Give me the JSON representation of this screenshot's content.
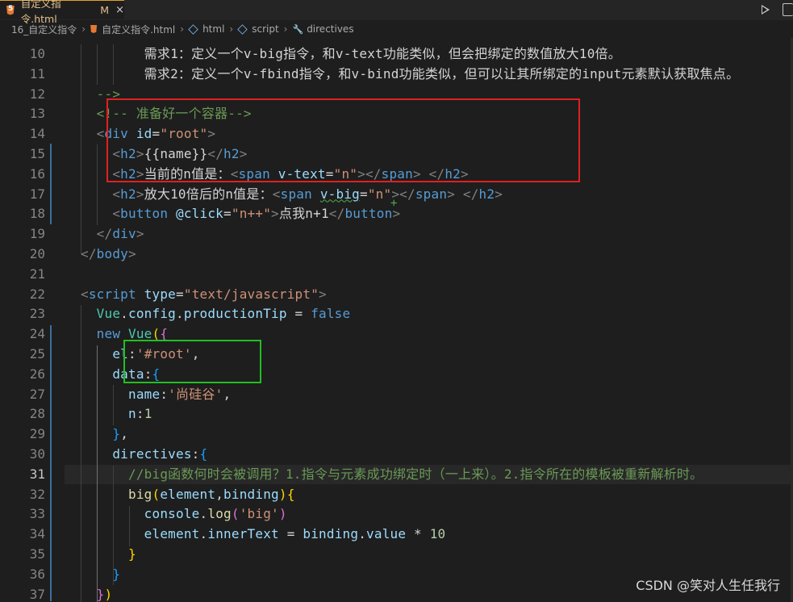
{
  "tab": {
    "title": "自定义指令.html",
    "modified": "M",
    "close": "×"
  },
  "breadcrumb": {
    "folder": "16_自定义指令",
    "file": "自定义指令.html",
    "items": [
      "html",
      "script",
      "directives"
    ]
  },
  "lines": [
    {
      "num": "10",
      "tokens": [
        [
          "txt",
          "        需求1：定义一个v-big指令，和v-text功能类似，但会把绑定的数值放大10倍。"
        ]
      ]
    },
    {
      "num": "11",
      "tokens": [
        [
          "txt",
          "        需求2：定义一个v-fbind指令，和v-bind功能类似，但可以让其所绑定的input元素默认获取焦点。"
        ]
      ]
    },
    {
      "num": "12",
      "tokens": [
        [
          "cmt",
          "  -->"
        ]
      ]
    },
    {
      "num": "13",
      "tokens": [
        [
          "cmt",
          "  <!-- 准备好一个容器-->"
        ]
      ]
    },
    {
      "num": "14",
      "tokens": [
        [
          "punct",
          "  <"
        ],
        [
          "tag",
          "div"
        ],
        [
          "txt",
          " "
        ],
        [
          "attr",
          "id"
        ],
        [
          "txt",
          "="
        ],
        [
          "str",
          "\"root\""
        ],
        [
          "punct",
          ">"
        ]
      ]
    },
    {
      "num": "15",
      "tokens": [
        [
          "punct",
          "    <"
        ],
        [
          "tag",
          "h2"
        ],
        [
          "punct",
          ">"
        ],
        [
          "txt",
          "{{name}}"
        ],
        [
          "punct",
          "</"
        ],
        [
          "tag",
          "h2"
        ],
        [
          "punct",
          ">"
        ]
      ]
    },
    {
      "num": "16",
      "tokens": [
        [
          "punct",
          "    <"
        ],
        [
          "tag",
          "h2"
        ],
        [
          "punct",
          ">"
        ],
        [
          "txt",
          "当前的n值是："
        ],
        [
          "punct",
          "<"
        ],
        [
          "tag",
          "span"
        ],
        [
          "txt",
          " "
        ],
        [
          "attr",
          "v-text"
        ],
        [
          "txt",
          "="
        ],
        [
          "str",
          "\"n\""
        ],
        [
          "punct",
          "></"
        ],
        [
          "tag",
          "span"
        ],
        [
          "punct",
          ">"
        ],
        [
          "txt",
          " "
        ],
        [
          "punct",
          "</"
        ],
        [
          "tag",
          "h2"
        ],
        [
          "punct",
          ">"
        ]
      ]
    },
    {
      "num": "17",
      "tokens": [
        [
          "punct",
          "    <"
        ],
        [
          "tag",
          "h2"
        ],
        [
          "punct",
          ">"
        ],
        [
          "txt",
          "放大10倍后的n值是："
        ],
        [
          "punct",
          "<"
        ],
        [
          "tag",
          "span"
        ],
        [
          "txt",
          " "
        ],
        [
          "attr squiggle",
          "v-big"
        ],
        [
          "txt",
          "="
        ],
        [
          "str",
          "\"n\""
        ],
        [
          "punct",
          "></"
        ],
        [
          "tag",
          "span"
        ],
        [
          "punct",
          ">"
        ],
        [
          "txt",
          " "
        ],
        [
          "punct",
          "</"
        ],
        [
          "tag",
          "h2"
        ],
        [
          "punct",
          ">"
        ]
      ]
    },
    {
      "num": "18",
      "tokens": [
        [
          "punct",
          "    <"
        ],
        [
          "tag",
          "button"
        ],
        [
          "txt",
          " "
        ],
        [
          "attr",
          "@click"
        ],
        [
          "txt",
          "="
        ],
        [
          "str",
          "\"n++\""
        ],
        [
          "punct",
          ">"
        ],
        [
          "txt",
          "点我n+1"
        ],
        [
          "punct",
          "</"
        ],
        [
          "tag",
          "button"
        ],
        [
          "punct",
          ">"
        ]
      ]
    },
    {
      "num": "19",
      "tokens": [
        [
          "punct",
          "  </"
        ],
        [
          "tag",
          "div"
        ],
        [
          "punct",
          ">"
        ]
      ]
    },
    {
      "num": "20",
      "tokens": [
        [
          "punct",
          "</"
        ],
        [
          "tag",
          "body"
        ],
        [
          "punct",
          ">"
        ]
      ]
    },
    {
      "num": "21",
      "tokens": []
    },
    {
      "num": "22",
      "tokens": [
        [
          "punct",
          "<"
        ],
        [
          "tag",
          "script"
        ],
        [
          "txt",
          " "
        ],
        [
          "attr",
          "type"
        ],
        [
          "txt",
          "="
        ],
        [
          "str",
          "\"text/javascript\""
        ],
        [
          "punct",
          ">"
        ]
      ]
    },
    {
      "num": "23",
      "tokens": [
        [
          "txt",
          "  "
        ],
        [
          "cls",
          "Vue"
        ],
        [
          "txt",
          "."
        ],
        [
          "var",
          "config"
        ],
        [
          "txt",
          "."
        ],
        [
          "var",
          "productionTip"
        ],
        [
          "txt",
          " = "
        ],
        [
          "kw",
          "false"
        ]
      ]
    },
    {
      "num": "24",
      "tokens": [
        [
          "txt",
          "  "
        ],
        [
          "kw",
          "new"
        ],
        [
          "txt",
          " "
        ],
        [
          "cls",
          "Vue"
        ],
        [
          "brk1",
          "("
        ],
        [
          "brk2",
          "{"
        ]
      ]
    },
    {
      "num": "25",
      "tokens": [
        [
          "txt",
          "    "
        ],
        [
          "var",
          "el"
        ],
        [
          "txt",
          ":"
        ],
        [
          "str",
          "'#root'"
        ],
        [
          "txt",
          ","
        ]
      ]
    },
    {
      "num": "26",
      "tokens": [
        [
          "txt",
          "    "
        ],
        [
          "var",
          "data"
        ],
        [
          "txt",
          ":"
        ],
        [
          "brk3",
          "{"
        ]
      ]
    },
    {
      "num": "27",
      "tokens": [
        [
          "txt",
          "      "
        ],
        [
          "var",
          "name"
        ],
        [
          "txt",
          ":"
        ],
        [
          "str",
          "'尚硅谷'"
        ],
        [
          "txt",
          ","
        ]
      ]
    },
    {
      "num": "28",
      "tokens": [
        [
          "txt",
          "      "
        ],
        [
          "var",
          "n"
        ],
        [
          "txt",
          ":"
        ],
        [
          "num",
          "1"
        ]
      ]
    },
    {
      "num": "29",
      "tokens": [
        [
          "txt",
          "    "
        ],
        [
          "brk3",
          "}"
        ],
        [
          "txt",
          ","
        ]
      ]
    },
    {
      "num": "30",
      "tokens": [
        [
          "txt",
          "    "
        ],
        [
          "var",
          "directives"
        ],
        [
          "txt",
          ":"
        ],
        [
          "brk3",
          "{"
        ]
      ]
    },
    {
      "num": "31",
      "tokens": [
        [
          "cmt",
          "      //big函数何时会被调用？1.指令与元素成功绑定时（一上来）。2.指令所在的模板被重新解析时。"
        ]
      ]
    },
    {
      "num": "32",
      "tokens": [
        [
          "txt",
          "      "
        ],
        [
          "fn",
          "big"
        ],
        [
          "brk1",
          "("
        ],
        [
          "var",
          "element"
        ],
        [
          "txt",
          ","
        ],
        [
          "var",
          "binding"
        ],
        [
          "brk1",
          ")"
        ],
        [
          "brk1",
          "{"
        ]
      ]
    },
    {
      "num": "33",
      "tokens": [
        [
          "txt",
          "        "
        ],
        [
          "var",
          "console"
        ],
        [
          "txt",
          "."
        ],
        [
          "fn",
          "log"
        ],
        [
          "brk2",
          "("
        ],
        [
          "str",
          "'big'"
        ],
        [
          "brk2",
          ")"
        ]
      ]
    },
    {
      "num": "34",
      "tokens": [
        [
          "txt",
          "        "
        ],
        [
          "var",
          "element"
        ],
        [
          "txt",
          "."
        ],
        [
          "var",
          "innerText"
        ],
        [
          "txt",
          " = "
        ],
        [
          "var",
          "binding"
        ],
        [
          "txt",
          "."
        ],
        [
          "var",
          "value"
        ],
        [
          "txt",
          " * "
        ],
        [
          "num",
          "10"
        ]
      ]
    },
    {
      "num": "35",
      "tokens": [
        [
          "txt",
          "      "
        ],
        [
          "brk1",
          "}"
        ]
      ]
    },
    {
      "num": "36",
      "tokens": [
        [
          "txt",
          "    "
        ],
        [
          "brk3",
          "}"
        ]
      ]
    },
    {
      "num": "37",
      "tokens": [
        [
          "txt",
          "  "
        ],
        [
          "brk2",
          "}"
        ],
        [
          "brk1",
          ")"
        ]
      ]
    }
  ],
  "active_line": "31",
  "watermark": "CSDN @笑对人生任我行",
  "colors": {
    "background": "#1e1e1e",
    "highlight_red": "#e02020",
    "highlight_green": "#20c020"
  }
}
